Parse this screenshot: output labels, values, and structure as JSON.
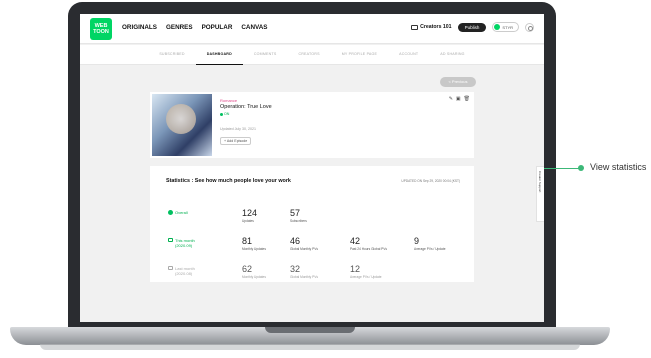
{
  "header": {
    "logo_text": "WEB TOON",
    "nav": [
      "ORIGINALS",
      "GENRES",
      "POPULAR",
      "CANVAS"
    ],
    "creators_label": "Creators 101",
    "publish_label": "Publish",
    "user_label": "STYR"
  },
  "tabs": [
    {
      "label": "SUBSCRIBED",
      "active": false
    },
    {
      "label": "DASHBOARD",
      "active": true
    },
    {
      "label": "COMMENTS",
      "active": false
    },
    {
      "label": "CREATORS",
      "active": false
    },
    {
      "label": "MY PROFILE PAGE",
      "active": false
    },
    {
      "label": "ACCOUNT",
      "active": false
    },
    {
      "label": "AD SHARING",
      "active": false
    }
  ],
  "previous_label": "< Previous",
  "series": {
    "genre": "Romance",
    "title": "Operation: True Love",
    "status": "ON",
    "updated": "Updated July 30, 2021",
    "add_episode": "+ Add Episode"
  },
  "stats": {
    "title": "Statistics : See how much people love your work",
    "updated": "UPDATED ON Sep 29, 2020 00:04 (KST)",
    "rows": {
      "overall": {
        "label": "Overall",
        "items": [
          {
            "value": "124",
            "label": "Updates"
          },
          {
            "value": "57",
            "label": "Subscribers"
          }
        ]
      },
      "this_month": {
        "label": "This month",
        "sub": "(2020.09)",
        "items": [
          {
            "value": "81",
            "label": "Monthly Updates"
          },
          {
            "value": "46",
            "label": "Global Monthly PVs"
          },
          {
            "value": "42",
            "label": "Past 24 Hours Global PVs"
          },
          {
            "value": "9",
            "label": "Average PVs / Update"
          }
        ]
      },
      "last_month": {
        "label": "Last month",
        "sub": "(2020.08)",
        "items": [
          {
            "value": "62",
            "label": "Monthly Updates"
          },
          {
            "value": "32",
            "label": "Global Monthly PVs"
          },
          {
            "value": "12",
            "label": "Average PVs / Update"
          }
        ]
      }
    }
  },
  "side_tab_label": "Creator Support",
  "annotation": "View statistics",
  "colors": {
    "brand": "#00d564",
    "accent_pink": "#e04a8a",
    "callout": "#3cb878"
  }
}
